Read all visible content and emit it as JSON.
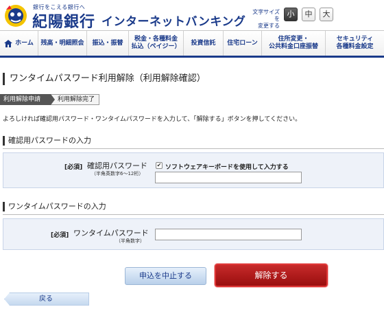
{
  "header": {
    "tagline": "銀行をこえる銀行へ",
    "bank_name": "紀陽銀行",
    "service_name": "インターネットバンキング",
    "fontsize_label_line1": "文字サイズを",
    "fontsize_label_line2": "変更する",
    "fontsize_options": [
      "小",
      "中",
      "大"
    ],
    "fontsize_selected": "小"
  },
  "nav": {
    "items": [
      {
        "line1": "ホーム",
        "line2": ""
      },
      {
        "line1": "残高・明細照会",
        "line2": ""
      },
      {
        "line1": "振込・振替",
        "line2": ""
      },
      {
        "line1": "税金・各種料金",
        "line2": "払込（ペイジー）"
      },
      {
        "line1": "投資信託",
        "line2": ""
      },
      {
        "line1": "住宅ローン",
        "line2": ""
      },
      {
        "line1": "住所変更・",
        "line2": "公共料金口座振替"
      },
      {
        "line1": "セキュリティ",
        "line2": "各種料金設定"
      }
    ]
  },
  "page": {
    "title": "ワンタイムパスワード利用解除（利用解除確認）",
    "steps": [
      "利用解除申請",
      "利用解除完了"
    ],
    "description": "よろしければ確認用パスワード・ワンタイムパスワードを入力して、「解除する」ボタンを押してください。"
  },
  "confirm_section": {
    "title": "確認用パスワードの入力",
    "required": "[必須]",
    "label": "確認用パスワード",
    "sublabel": "（半角英数字6〜12桁）",
    "checkbox_label": "ソフトウェアキーボードを使用して入力する",
    "checkbox_checked": true,
    "value": ""
  },
  "otp_section": {
    "title": "ワンタイムパスワードの入力",
    "required": "[必須]",
    "label": "ワンタイムパスワード",
    "sublabel": "（半角数字）",
    "value": ""
  },
  "actions": {
    "cancel_label": "申込を中止する",
    "release_label": "解除する",
    "back_label": "戻る"
  },
  "colors": {
    "brand": "#1a3a8a",
    "release": "#b01818",
    "panel": "#eef2f9"
  }
}
